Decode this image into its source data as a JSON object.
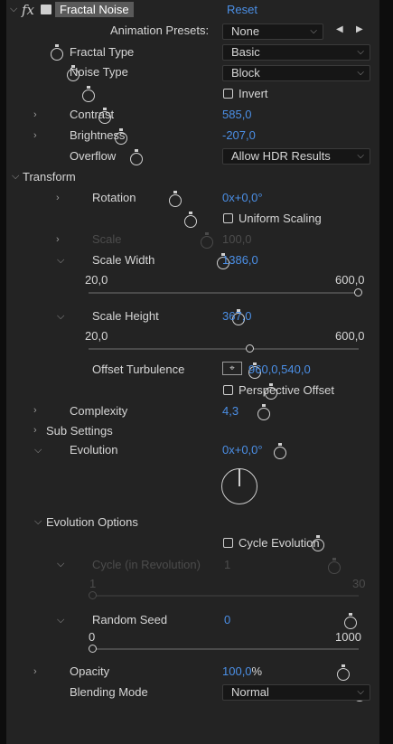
{
  "header": {
    "fx": "fx",
    "effect_name": "Fractal Noise",
    "reset": "Reset"
  },
  "animation_presets": {
    "label": "Animation Presets:",
    "value": "None"
  },
  "fractal_type": {
    "label": "Fractal Type",
    "value": "Basic"
  },
  "noise_type": {
    "label": "Noise Type",
    "value": "Block"
  },
  "invert": {
    "label": "Invert",
    "checked": false
  },
  "contrast": {
    "label": "Contrast",
    "value": "585,0"
  },
  "brightness": {
    "label": "Brightness",
    "value": "-207,0"
  },
  "overflow": {
    "label": "Overflow",
    "value": "Allow HDR Results"
  },
  "transform": {
    "label": "Transform",
    "rotation": {
      "label": "Rotation",
      "value": "0x+0,0°"
    },
    "uniform_scaling": {
      "label": "Uniform Scaling",
      "checked": false
    },
    "scale": {
      "label": "Scale",
      "value": "100,0"
    },
    "scale_width": {
      "label": "Scale Width",
      "value": "1386,0",
      "min": "20,0",
      "max": "600,0",
      "slider_fraction": 1.0
    },
    "scale_height": {
      "label": "Scale Height",
      "value": "367,0",
      "min": "20,0",
      "max": "600,0",
      "slider_fraction": 0.6
    },
    "offset_turbulence": {
      "label": "Offset Turbulence",
      "value": "960,0,540,0"
    },
    "perspective_offset": {
      "label": "Perspective Offset",
      "checked": false
    }
  },
  "complexity": {
    "label": "Complexity",
    "value": "4,3"
  },
  "sub_settings": {
    "label": "Sub Settings"
  },
  "evolution": {
    "label": "Evolution",
    "value": "0x+0,0°"
  },
  "evolution_options": {
    "label": "Evolution Options",
    "cycle_evolution": {
      "label": "Cycle Evolution",
      "checked": false
    },
    "cycle_in_revolution": {
      "label": "Cycle (in Revolution)",
      "value": "1",
      "min": "1",
      "max": "30",
      "slider_fraction": 0.0
    },
    "random_seed": {
      "label": "Random Seed",
      "value": "0",
      "min": "0",
      "max": "1000",
      "slider_fraction": 0.0
    }
  },
  "opacity": {
    "label": "Opacity",
    "value": "100,0",
    "unit": "%"
  },
  "blending_mode": {
    "label": "Blending Mode",
    "value": "Normal"
  },
  "icons": [
    "twirl-arrow-icon",
    "stopwatch-icon",
    "effect-icon",
    "nav-arrows-icon",
    "crosshair-icon",
    "chevron-down-icon"
  ]
}
